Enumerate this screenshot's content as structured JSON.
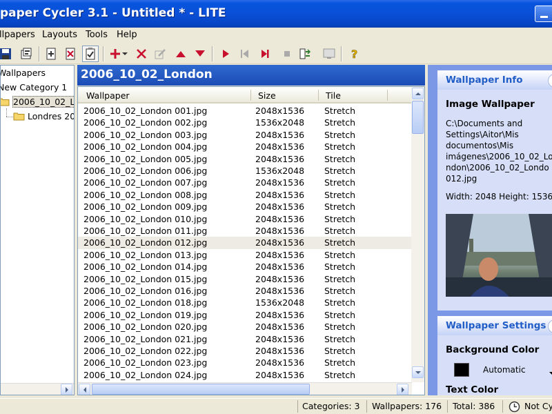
{
  "window": {
    "title": "paper Cycler 3.1 - Untitled * - LITE"
  },
  "menu": [
    "llpapers",
    "Layouts",
    "Tools",
    "Help"
  ],
  "toolbar": {
    "icons": [
      "save-icon",
      "properties-icon",
      "add-wallpaper-icon",
      "delete-wallpaper-icon",
      "checklist-icon",
      "add-icon",
      "dropdown-arrow-icon",
      "remove-icon",
      "edit-icon",
      "move-up-icon",
      "move-down-icon",
      "play-icon",
      "first-icon",
      "last-icon",
      "stop-icon",
      "settings-icon",
      "monitor-icon",
      "help-icon"
    ],
    "colors": {
      "red": "#C8102E",
      "green": "#2E7D32",
      "gray": "#9A9A9A"
    }
  },
  "tree": {
    "items": [
      {
        "label": "Wallpapers"
      },
      {
        "label": "New Category 1"
      },
      {
        "label": "2006_10_02_L"
      },
      {
        "label": "Londres 20"
      }
    ]
  },
  "main": {
    "title": "2006_10_02_London",
    "columns": [
      "Wallpaper",
      "Size",
      "Tile"
    ],
    "rows": [
      [
        "2006_10_02_London 001.jpg",
        "2048x1536",
        "Stretch"
      ],
      [
        "2006_10_02_London 002.jpg",
        "1536x2048",
        "Stretch"
      ],
      [
        "2006_10_02_London 003.jpg",
        "2048x1536",
        "Stretch"
      ],
      [
        "2006_10_02_London 004.jpg",
        "2048x1536",
        "Stretch"
      ],
      [
        "2006_10_02_London 005.jpg",
        "2048x1536",
        "Stretch"
      ],
      [
        "2006_10_02_London 006.jpg",
        "1536x2048",
        "Stretch"
      ],
      [
        "2006_10_02_London 007.jpg",
        "2048x1536",
        "Stretch"
      ],
      [
        "2006_10_02_London 008.jpg",
        "2048x1536",
        "Stretch"
      ],
      [
        "2006_10_02_London 009.jpg",
        "2048x1536",
        "Stretch"
      ],
      [
        "2006_10_02_London 010.jpg",
        "2048x1536",
        "Stretch"
      ],
      [
        "2006_10_02_London 011.jpg",
        "2048x1536",
        "Stretch"
      ],
      [
        "2006_10_02_London 012.jpg",
        "2048x1536",
        "Stretch"
      ],
      [
        "2006_10_02_London 013.jpg",
        "2048x1536",
        "Stretch"
      ],
      [
        "2006_10_02_London 014.jpg",
        "2048x1536",
        "Stretch"
      ],
      [
        "2006_10_02_London 015.jpg",
        "2048x1536",
        "Stretch"
      ],
      [
        "2006_10_02_London 016.jpg",
        "2048x1536",
        "Stretch"
      ],
      [
        "2006_10_02_London 018.jpg",
        "1536x2048",
        "Stretch"
      ],
      [
        "2006_10_02_London 019.jpg",
        "2048x1536",
        "Stretch"
      ],
      [
        "2006_10_02_London 020.jpg",
        "2048x1536",
        "Stretch"
      ],
      [
        "2006_10_02_London 021.jpg",
        "2048x1536",
        "Stretch"
      ],
      [
        "2006_10_02_London 022.jpg",
        "2048x1536",
        "Stretch"
      ],
      [
        "2006_10_02_London 023.jpg",
        "2048x1536",
        "Stretch"
      ],
      [
        "2006_10_02_London 024.jpg",
        "2048x1536",
        "Stretch"
      ]
    ],
    "selected_row": 11
  },
  "info": {
    "title": "Wallpaper Info",
    "type": "Image Wallpaper",
    "path_lines": [
      "C:\\Documents and",
      "Settings\\Aitor\\Mis",
      "documentos\\Mis",
      "imágenes\\2006_10_02_Lo",
      "ndon\\2006_10_02_Londo",
      "012.jpg"
    ],
    "dimensions": "Width: 2048  Height: 1536"
  },
  "settings": {
    "title": "Wallpaper Settings",
    "bg_label": "Background Color",
    "bg_value": "Automatic",
    "text_label": "Text Color"
  },
  "status": {
    "categories": "Categories: 3",
    "wallpapers": "Wallpapers: 176",
    "total": "Total: 386",
    "cycling": "Not Cy"
  }
}
